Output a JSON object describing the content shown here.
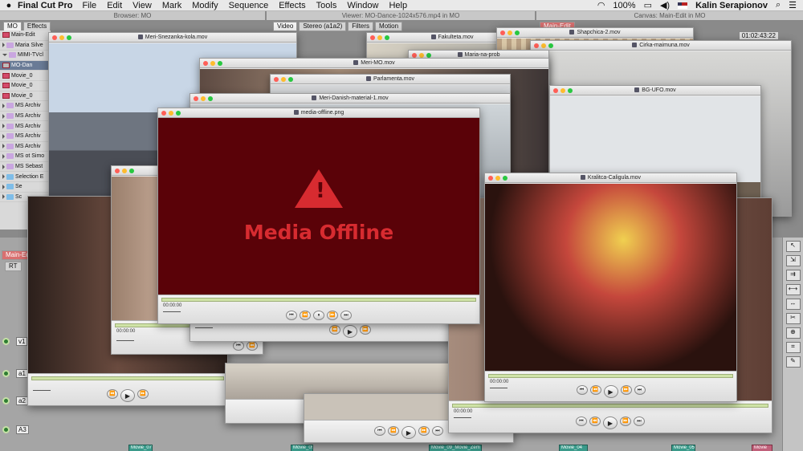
{
  "menubar": {
    "apple": "",
    "app_name": "Final Cut Pro",
    "items": [
      "File",
      "Edit",
      "View",
      "Mark",
      "Modify",
      "Sequence",
      "Effects",
      "Tools",
      "Window",
      "Help"
    ],
    "battery": "100%",
    "user": "Kalin Serapionov"
  },
  "panels": {
    "browser_title": "Browser: MO",
    "browser_tabs": [
      "MO",
      "Effects"
    ],
    "viewer_title": "Viewer: MO-Dance-1024x576.mp4 in MO",
    "viewer_tabs": [
      "Video",
      "Stereo (a1a2)",
      "Filters",
      "Motion"
    ],
    "canvas_title": "Canvas: Main-Edit in MO",
    "canvas_tab": "Main-Edit",
    "canvas_timecode": "01:02:43:22"
  },
  "browser_items": [
    {
      "label": "Main-Edit",
      "kind": "seq"
    },
    {
      "label": "Maria Silve",
      "kind": "folder"
    },
    {
      "label": "MIMI-TVcl",
      "kind": "folder"
    },
    {
      "label": "MO-Dan",
      "kind": "seq",
      "selected": true
    },
    {
      "label": "Movie_0",
      "kind": "seq"
    },
    {
      "label": "Movie_0",
      "kind": "seq"
    },
    {
      "label": "Movie_0",
      "kind": "seq"
    },
    {
      "label": "MS Archiv",
      "kind": "folder"
    },
    {
      "label": "MS Archiv",
      "kind": "folder"
    },
    {
      "label": "MS Archiv",
      "kind": "folder"
    },
    {
      "label": "MS Archiv",
      "kind": "folder"
    },
    {
      "label": "MS Archiv",
      "kind": "folder"
    },
    {
      "label": "MS ot Simo",
      "kind": "folder"
    },
    {
      "label": "MS Sebast",
      "kind": "folder"
    },
    {
      "label": "Selection E",
      "kind": "folder"
    },
    {
      "label": "Se",
      "kind": "folder"
    },
    {
      "label": "Sc",
      "kind": "folder"
    }
  ],
  "timeline": {
    "tab": "Main-Edi",
    "rt": "RT",
    "tracks": [
      "v1",
      "a1",
      "a2",
      "A3"
    ],
    "clips": [
      "Movie_07",
      "Movie_09",
      "Movie_09_Movie_Zem",
      "Movie_04",
      "Movie_05",
      "Movie"
    ]
  },
  "windows": [
    {
      "title": "Meri-Snezanka-kola.mov"
    },
    {
      "title": "Fakulteta.mov"
    },
    {
      "title": "Shapchica-2.mov"
    },
    {
      "title": "Cirka-maimuna.mov"
    },
    {
      "title": "Maria-na-prob"
    },
    {
      "title": "Meri-MO.mov"
    },
    {
      "title": "Parlamenta.mov"
    },
    {
      "title": "Meri-Danish-material-1.mov"
    },
    {
      "title": "BG-UFO.mov"
    },
    {
      "title": "media-offline.png"
    },
    {
      "title": "Kralitca-Caligula.mov"
    }
  ],
  "player": {
    "timecode": "00:00:00",
    "btn_prev": "⏮",
    "btn_back": "⏪",
    "btn_play": "▶",
    "btn_pause": "⏸",
    "btn_fwd": "⏩",
    "btn_next": "⏭"
  },
  "offline": {
    "icon": "!",
    "message": "Media Offline"
  },
  "colors": {
    "offline_bg": "#5a0208",
    "offline_accent": "#d72b30",
    "clip_teal": "#3a9a8a"
  }
}
